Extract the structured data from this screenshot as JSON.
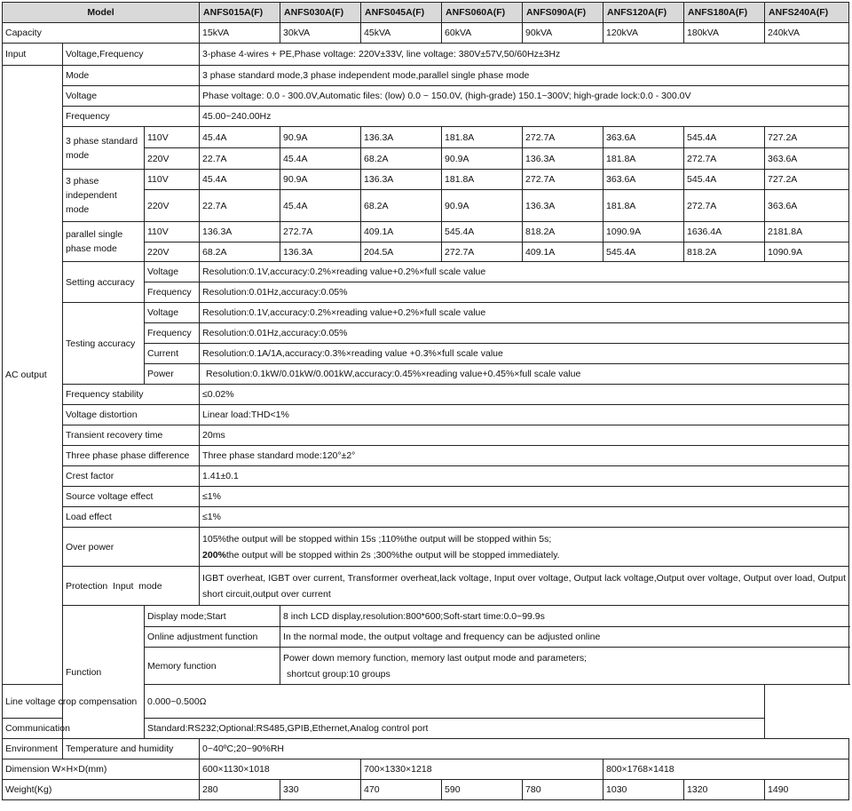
{
  "header": {
    "model_label": "Model",
    "models": [
      "ANFS015A(F)",
      "ANFS030A(F)",
      "ANFS045A(F)",
      "ANFS060A(F)",
      "ANFS090A(F)",
      "ANFS120A(F)",
      "ANFS180A(F)",
      "ANFS240A(F)"
    ]
  },
  "capacity": {
    "label": "Capacity",
    "values": [
      "15kVA",
      "30kVA",
      "45kVA",
      "60kVA",
      "90kVA",
      "120kVA",
      "180kVA",
      "240kVA"
    ]
  },
  "input": {
    "group": "Input",
    "label": "Voltage,Frequency",
    "value": "3-phase 4-wires + PE,Phase voltage: 220V±33V, line voltage: 380V±57V,50/60Hz±3Hz"
  },
  "ac_output": {
    "group": "AC output",
    "mode": {
      "label": "Mode",
      "value": "3 phase standard mode,3 phase independent mode,parallel single phase mode"
    },
    "voltage": {
      "label": "Voltage",
      "value": "Phase voltage: 0.0 - 300.0V,Automatic files: (low) 0.0 ~ 150.0V, (high-grade) 150.1~300V; high-grade lock:0.0 - 300.0V"
    },
    "frequency": {
      "label": "Frequency",
      "value": "45.00~240.00Hz"
    },
    "current_groups": [
      {
        "label": "3 phase standard mode",
        "rows": [
          {
            "v": "110V",
            "values": [
              "45.4A",
              "90.9A",
              "136.3A",
              "181.8A",
              "272.7A",
              "363.6A",
              "545.4A",
              "727.2A"
            ]
          },
          {
            "v": "220V",
            "values": [
              "22.7A",
              "45.4A",
              "68.2A",
              "90.9A",
              "136.3A",
              "181.8A",
              "272.7A",
              "363.6A"
            ]
          }
        ]
      },
      {
        "label": "3 phase independent mode",
        "rows": [
          {
            "v": "110V",
            "values": [
              "45.4A",
              "90.9A",
              "136.3A",
              "181.8A",
              "272.7A",
              "363.6A",
              "545.4A",
              "727.2A"
            ]
          },
          {
            "v": "220V",
            "values": [
              "22.7A",
              "45.4A",
              "68.2A",
              "90.9A",
              "136.3A",
              "181.8A",
              "272.7A",
              "363.6A"
            ]
          }
        ]
      },
      {
        "label": "parallel single phase mode",
        "rows": [
          {
            "v": "110V",
            "values": [
              "136.3A",
              "272.7A",
              "409.1A",
              "545.4A",
              "818.2A",
              "1090.9A",
              "1636.4A",
              "2181.8A"
            ]
          },
          {
            "v": "220V",
            "values": [
              "68.2A",
              "136.3A",
              "204.5A",
              "272.7A",
              "409.1A",
              "545.4A",
              "818.2A",
              "1090.9A"
            ]
          }
        ]
      }
    ],
    "setting_accuracy": {
      "label": "Setting accuracy",
      "rows": [
        {
          "label": "Voltage",
          "value": "Resolution:0.1V,accuracy:0.2%×reading value+0.2%×full scale value"
        },
        {
          "label": "Frequency",
          "value": "Resolution:0.01Hz,accuracy:0.05%"
        }
      ]
    },
    "testing_accuracy": {
      "label": "Testing accuracy",
      "rows": [
        {
          "label": "Voltage",
          "value": "Resolution:0.1V,accuracy:0.2%×reading value+0.2%×full scale value"
        },
        {
          "label": "Frequency",
          "value": "Resolution:0.01Hz,accuracy:0.05%"
        },
        {
          "label": "Current",
          "value": "Resolution:0.1A/1A,accuracy:0.3%×reading value +0.3%×full scale value"
        },
        {
          "label": "Power",
          "value": "Resolution:0.1kW/0.01kW/0.001kW,accuracy:0.45%×reading value+0.45%×full scale value"
        }
      ]
    },
    "simple_rows": [
      {
        "label": "Frequency stability",
        "value": "≤0.02%"
      },
      {
        "label": "Voltage distortion",
        "value": "Linear load:THD<1%"
      },
      {
        "label": "Transient recovery time",
        "value": "20ms"
      },
      {
        "label": "Three phase phase difference",
        "value": "Three phase standard mode:120°±2°"
      },
      {
        "label": "Crest factor",
        "value": "1.41±0.1"
      },
      {
        "label": "Source voltage effect",
        "value": "≤1%"
      },
      {
        "label": "Load effect",
        "value": "≤1%"
      }
    ],
    "over_power": {
      "label": "Over power",
      "line1": "105%the output will be stopped within 15s ;110%the output will be stopped within 5s;",
      "line2_bold": "200%",
      "line2_rest": "the output will be stopped within 2s ;300%the output will be stopped immediately."
    },
    "protection": {
      "label": "Protection  Input  mode",
      "value": "IGBT overheat, IGBT over current, Transformer overheat,lack voltage, Input over voltage, Output lack voltage,Output over voltage, Output over load, Output short circuit,output over current"
    }
  },
  "function": {
    "group": "Function",
    "rows": [
      {
        "label": "Display mode;Start",
        "value": "8 inch LCD display,resolution:800*600;Soft-start time:0.0~99.9s"
      },
      {
        "label": "Online adjustment function",
        "value": "In the normal mode, the output voltage and frequency can be adjusted online"
      },
      {
        "label": "Memory function",
        "value": "Power down memory function, memory last output mode and parameters;",
        "value2": "shortcut group:10 groups"
      },
      {
        "label": "Line voltage crop compensation",
        "value": "0.000~0.500Ω"
      },
      {
        "label": "Communication",
        "value": "Standard:RS232;Optional:RS485,GPIB,Ethernet,Analog control port"
      }
    ]
  },
  "environment": {
    "group": "Environment",
    "label": "Temperature and humidity",
    "value": "0~40ºC;20~90%RH"
  },
  "dimension": {
    "label": "Dimension W×H×D(mm)",
    "values": [
      "600×1130×1018",
      "700×1330×1218",
      "800×1768×1418"
    ]
  },
  "weight": {
    "label": "Weight(Kg)",
    "values": [
      "280",
      "330",
      "470",
      "590",
      "780",
      "1030",
      "1320",
      "1490"
    ]
  }
}
